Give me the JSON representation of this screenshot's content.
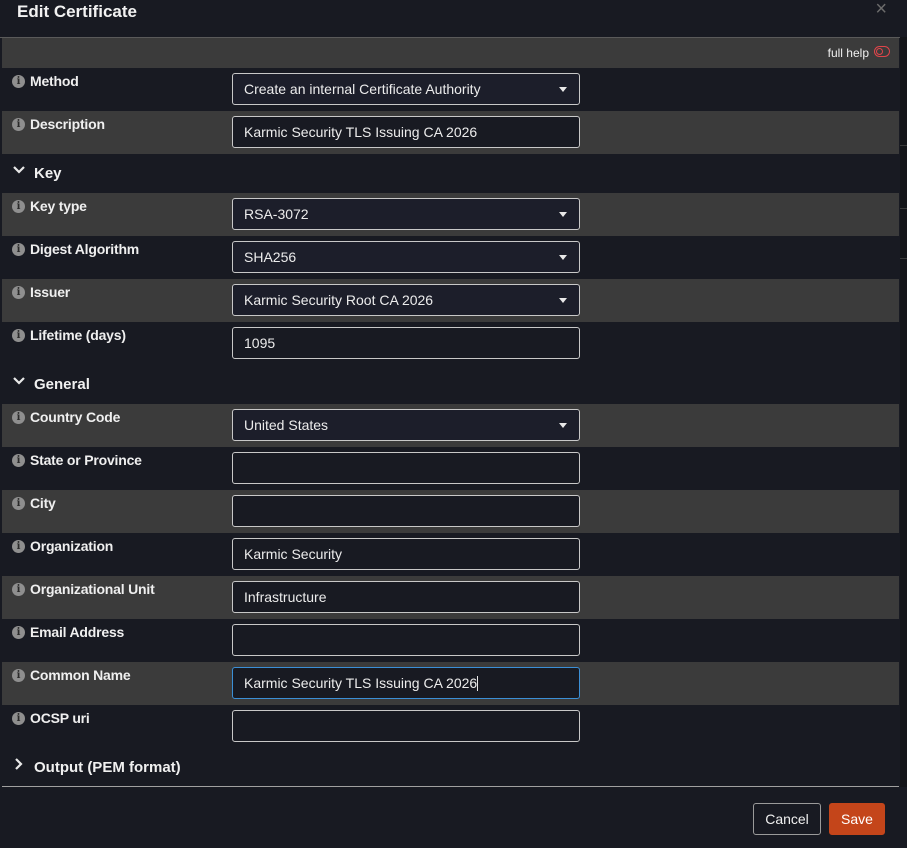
{
  "dialog": {
    "title": "Edit Certificate",
    "close_glyph": "×",
    "full_help_label": "full help"
  },
  "rows_top": [
    {
      "label": "Method",
      "type": "select",
      "value": "Create an internal Certificate Authority"
    },
    {
      "label": "Description",
      "type": "input",
      "value": "Karmic Security TLS Issuing CA 2026"
    }
  ],
  "sections": {
    "key": "Key",
    "general": "General",
    "output": "Output (PEM format)"
  },
  "key_rows": [
    {
      "label": "Key type",
      "type": "select",
      "value": "RSA-3072"
    },
    {
      "label": "Digest Algorithm",
      "type": "select",
      "value": "SHA256"
    },
    {
      "label": "Issuer",
      "type": "select",
      "value": "Karmic Security Root CA 2026"
    },
    {
      "label": "Lifetime (days)",
      "type": "input",
      "value": "1095"
    }
  ],
  "general_rows": [
    {
      "label": "Country Code",
      "type": "select",
      "value": "United States"
    },
    {
      "label": "State or Province",
      "type": "input",
      "value": ""
    },
    {
      "label": "City",
      "type": "input",
      "value": ""
    },
    {
      "label": "Organization",
      "type": "input",
      "value": "Karmic Security"
    },
    {
      "label": "Organizational Unit",
      "type": "input",
      "value": "Infrastructure"
    },
    {
      "label": "Email Address",
      "type": "input",
      "value": ""
    },
    {
      "label": "Common Name",
      "type": "input",
      "value": "Karmic Security TLS Issuing CA 2026"
    },
    {
      "label": "OCSP uri",
      "type": "input",
      "value": ""
    }
  ],
  "footer": {
    "cancel_label": "Cancel",
    "save_label": "Save"
  },
  "colors": {
    "save_button": "#c4451a",
    "focus_border": "#3b8fd6",
    "toggle_off": "#e0454a",
    "row_alt": "#3b3b3b",
    "background": "#181a22"
  },
  "icons": {
    "info": "info-icon",
    "close": "close-icon",
    "toggle": "toggle-off-icon",
    "expanded": "chevron-down-icon",
    "collapsed": "chevron-right-icon"
  }
}
